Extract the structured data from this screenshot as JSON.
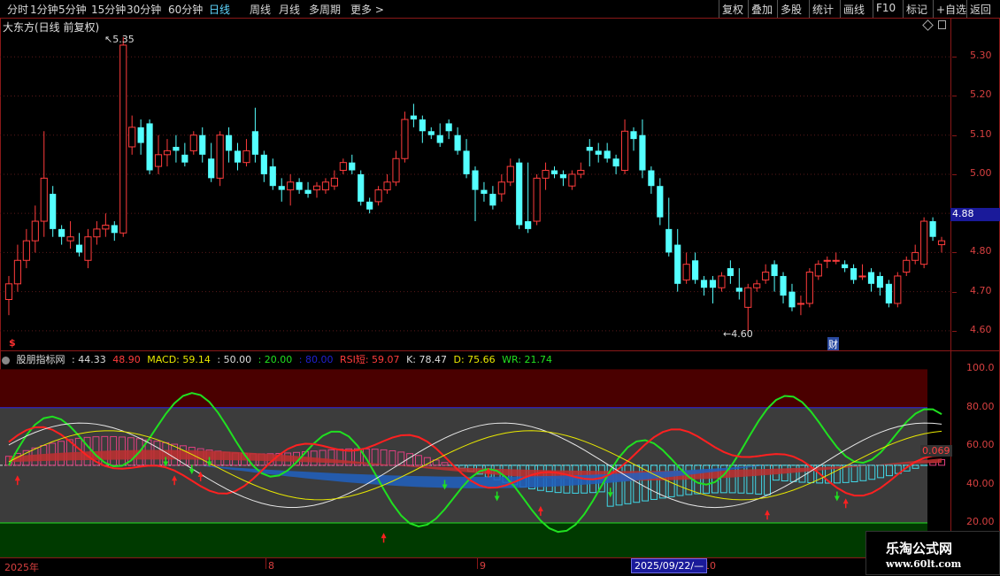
{
  "toolbar": {
    "periods": [
      "分时",
      "1分钟",
      "5分钟",
      "15分钟",
      "30分钟",
      "60分钟",
      "日线",
      "周线",
      "月线",
      "多周期",
      "更多 >"
    ],
    "active_period": "日线",
    "right_buttons": [
      "复权",
      "叠加",
      "多股",
      "统计",
      "画线",
      "F10",
      "标记",
      "+自选",
      "返回"
    ]
  },
  "price_chart": {
    "title": "大东方(日线 前复权)",
    "axis_ticks": [
      "5.30",
      "5.20",
      "5.10",
      "5.00",
      "4.90",
      "4.80",
      "4.70",
      "4.60"
    ],
    "current_price": "4.88",
    "high_marker": "5.35",
    "low_marker": "4.60",
    "finance_marker": "财",
    "dividend_marker": "$",
    "colors": {
      "up": "#ff3c3c",
      "down": "#54ffff",
      "axis": "#d84040"
    }
  },
  "indicator": {
    "header": {
      "name": "股朋指标网",
      "v1": ": 44.33",
      "v2": "48.90",
      "macd": "MACD: 59.14",
      "v3": ": 50.00",
      "v4": ": 20.00",
      "v5": ": 80.00",
      "rsi": "RSI短: 59.07",
      "k": "K: 78.47",
      "d": "D: 75.66",
      "wr": "WR: 21.74"
    },
    "axis_ticks": [
      "100.0",
      "80.00",
      "60.00",
      "40.00",
      "20.00"
    ],
    "macd_value": "0.069"
  },
  "time_axis": {
    "labels": [
      "2025年",
      "8",
      "9",
      "10"
    ],
    "cursor_date": "2025/09/22/—"
  },
  "watermark": {
    "line1": "乐淘公式网",
    "line2": "www.60lt.com"
  },
  "chart_data": {
    "type": "candlestick",
    "ylim": [
      4.55,
      5.4
    ],
    "candles": [
      [
        4.68,
        4.72,
        4.64,
        4.74
      ],
      [
        4.72,
        4.78,
        4.7,
        4.82
      ],
      [
        4.78,
        4.83,
        4.76,
        4.86
      ],
      [
        4.83,
        4.88,
        4.8,
        4.92
      ],
      [
        4.88,
        4.99,
        4.84,
        5.11
      ],
      [
        4.95,
        4.86,
        4.84,
        4.97
      ],
      [
        4.86,
        4.84,
        4.82,
        4.87
      ],
      [
        4.83,
        4.84,
        4.81,
        4.88
      ],
      [
        4.82,
        4.8,
        4.79,
        4.85
      ],
      [
        4.78,
        4.84,
        4.76,
        4.86
      ],
      [
        4.84,
        4.86,
        4.82,
        4.88
      ],
      [
        4.86,
        4.87,
        4.84,
        4.9
      ],
      [
        4.87,
        4.85,
        4.83,
        4.88
      ],
      [
        4.85,
        5.33,
        4.84,
        5.35
      ],
      [
        5.07,
        5.12,
        5.05,
        5.15
      ],
      [
        5.12,
        5.08,
        5.05,
        5.14
      ],
      [
        5.13,
        5.01,
        5.0,
        5.14
      ],
      [
        5.02,
        5.05,
        5.0,
        5.1
      ],
      [
        5.05,
        5.06,
        5.02,
        5.09
      ],
      [
        5.07,
        5.06,
        5.03,
        5.1
      ],
      [
        5.05,
        5.03,
        5.02,
        5.08
      ],
      [
        5.06,
        5.1,
        5.05,
        5.11
      ],
      [
        5.1,
        5.05,
        5.03,
        5.12
      ],
      [
        5.04,
        4.99,
        4.98,
        5.08
      ],
      [
        4.99,
        5.1,
        4.97,
        5.11
      ],
      [
        5.1,
        5.06,
        5.03,
        5.12
      ],
      [
        5.06,
        5.03,
        5.01,
        5.08
      ],
      [
        5.03,
        5.06,
        5.02,
        5.09
      ],
      [
        5.11,
        5.05,
        5.03,
        5.17
      ],
      [
        5.05,
        5.0,
        4.98,
        5.06
      ],
      [
        5.02,
        4.97,
        4.96,
        5.04
      ],
      [
        4.97,
        4.96,
        4.93,
        4.99
      ],
      [
        4.96,
        4.98,
        4.92,
        5.0
      ],
      [
        4.98,
        4.96,
        4.95,
        4.99
      ],
      [
        4.96,
        4.95,
        4.94,
        4.98
      ],
      [
        4.96,
        4.97,
        4.94,
        4.98
      ],
      [
        4.96,
        4.98,
        4.95,
        4.99
      ],
      [
        4.97,
        4.99,
        4.96,
        5.01
      ],
      [
        5.01,
        5.03,
        5.0,
        5.04
      ],
      [
        5.03,
        5.01,
        5.0,
        5.05
      ],
      [
        5.0,
        4.93,
        4.92,
        5.01
      ],
      [
        4.93,
        4.91,
        4.9,
        4.94
      ],
      [
        4.93,
        4.96,
        4.92,
        4.97
      ],
      [
        4.96,
        4.98,
        4.95,
        5.0
      ],
      [
        4.98,
        5.04,
        4.97,
        5.06
      ],
      [
        5.04,
        5.14,
        5.03,
        5.16
      ],
      [
        5.15,
        5.14,
        5.12,
        5.18
      ],
      [
        5.14,
        5.11,
        5.08,
        5.15
      ],
      [
        5.11,
        5.1,
        5.09,
        5.12
      ],
      [
        5.1,
        5.08,
        5.07,
        5.13
      ],
      [
        5.13,
        5.11,
        5.09,
        5.14
      ],
      [
        5.1,
        5.06,
        5.05,
        5.12
      ],
      [
        5.06,
        5.0,
        4.99,
        5.09
      ],
      [
        5.01,
        4.96,
        4.88,
        5.02
      ],
      [
        4.96,
        4.95,
        4.93,
        4.98
      ],
      [
        4.95,
        4.92,
        4.91,
        4.97
      ],
      [
        4.95,
        4.98,
        4.93,
        5.0
      ],
      [
        4.98,
        5.02,
        4.97,
        5.04
      ],
      [
        5.03,
        4.87,
        4.86,
        5.04
      ],
      [
        4.88,
        4.86,
        4.85,
        5.03
      ],
      [
        4.88,
        4.99,
        4.87,
        5.0
      ],
      [
        4.99,
        5.01,
        4.96,
        5.03
      ],
      [
        5.01,
        5.0,
        4.99,
        5.02
      ],
      [
        5.0,
        4.99,
        4.97,
        5.01
      ],
      [
        4.97,
        5.0,
        4.96,
        5.01
      ],
      [
        5.0,
        5.01,
        4.99,
        5.03
      ],
      [
        5.07,
        5.06,
        5.02,
        5.09
      ],
      [
        5.06,
        5.05,
        5.03,
        5.08
      ],
      [
        5.06,
        5.04,
        5.03,
        5.08
      ],
      [
        5.04,
        5.02,
        5.0,
        5.05
      ],
      [
        5.01,
        5.11,
        5.0,
        5.14
      ],
      [
        5.11,
        5.09,
        5.06,
        5.12
      ],
      [
        5.1,
        5.01,
        4.99,
        5.14
      ],
      [
        5.01,
        4.97,
        4.95,
        5.02
      ],
      [
        4.97,
        4.89,
        4.87,
        4.99
      ],
      [
        4.86,
        4.8,
        4.79,
        4.94
      ],
      [
        4.82,
        4.72,
        4.7,
        4.86
      ],
      [
        4.73,
        4.77,
        4.72,
        4.8
      ],
      [
        4.78,
        4.73,
        4.72,
        4.8
      ],
      [
        4.73,
        4.71,
        4.69,
        4.74
      ],
      [
        4.73,
        4.71,
        4.67,
        4.74
      ],
      [
        4.71,
        4.74,
        4.7,
        4.75
      ],
      [
        4.76,
        4.74,
        4.72,
        4.78
      ],
      [
        4.71,
        4.7,
        4.68,
        4.76
      ],
      [
        4.66,
        4.71,
        4.6,
        4.72
      ],
      [
        4.71,
        4.72,
        4.7,
        4.73
      ],
      [
        4.73,
        4.75,
        4.72,
        4.77
      ],
      [
        4.77,
        4.74,
        4.7,
        4.78
      ],
      [
        4.74,
        4.69,
        4.67,
        4.75
      ],
      [
        4.7,
        4.66,
        4.65,
        4.72
      ],
      [
        4.67,
        4.67,
        4.64,
        4.69
      ],
      [
        4.67,
        4.75,
        4.66,
        4.76
      ],
      [
        4.74,
        4.77,
        4.73,
        4.78
      ],
      [
        4.78,
        4.78,
        4.76,
        4.79
      ],
      [
        4.78,
        4.78,
        4.77,
        4.8
      ],
      [
        4.77,
        4.76,
        4.75,
        4.78
      ],
      [
        4.76,
        4.73,
        4.72,
        4.77
      ],
      [
        4.74,
        4.74,
        4.73,
        4.77
      ],
      [
        4.75,
        4.72,
        4.7,
        4.76
      ],
      [
        4.74,
        4.71,
        4.69,
        4.75
      ],
      [
        4.72,
        4.67,
        4.66,
        4.73
      ],
      [
        4.67,
        4.74,
        4.66,
        4.75
      ],
      [
        4.75,
        4.78,
        4.74,
        4.79
      ],
      [
        4.78,
        4.8,
        4.77,
        4.82
      ],
      [
        4.77,
        4.88,
        4.76,
        4.89
      ],
      [
        4.88,
        4.84,
        4.83,
        4.89
      ],
      [
        4.82,
        4.83,
        4.8,
        4.84
      ]
    ]
  }
}
